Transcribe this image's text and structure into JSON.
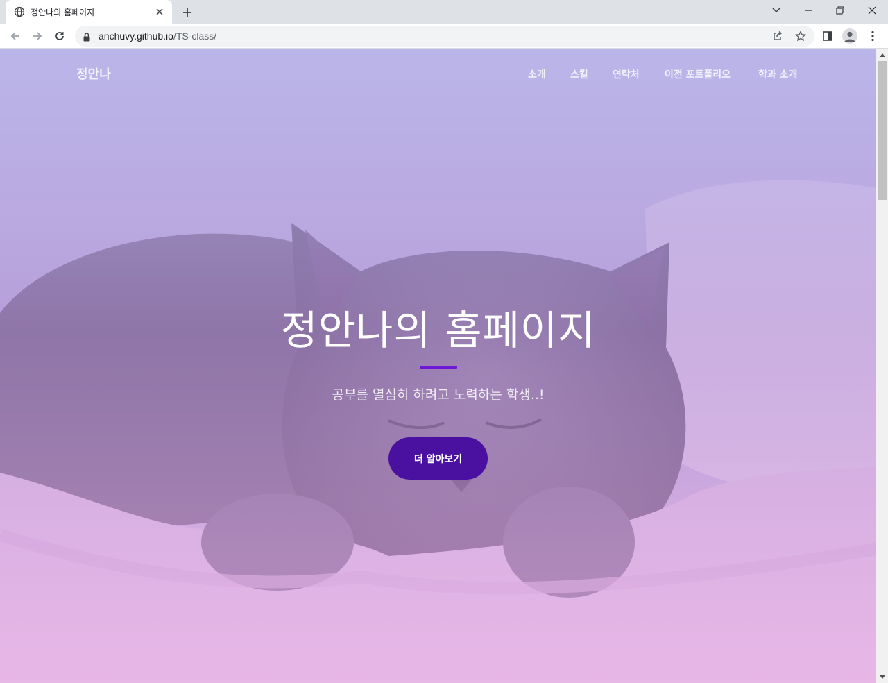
{
  "browser": {
    "tab_title": "정안나의 홈페이지",
    "url_host": "anchuvy.github.io",
    "url_path": "/TS-class/"
  },
  "site": {
    "brand": "정안나",
    "nav": [
      "소개",
      "스킬",
      "연락처",
      "이전 포트폴리오",
      "학과 소개"
    ],
    "hero_title": "정안나의 홈페이지",
    "hero_subtitle": "공부를 열심히 하려고 노력하는 학생..!",
    "cta_label": "더 알아보기"
  },
  "colors": {
    "accent": "#6f17d6",
    "cta_bg": "#4a10a0",
    "overlay_top": "#b2ace8",
    "overlay_bottom": "#e1a0e1"
  },
  "icons": {
    "tab": "globe-icon",
    "toolbar": [
      "back-icon",
      "forward-icon",
      "reload-icon",
      "lock-icon",
      "share-icon",
      "star-icon",
      "side-panel-icon",
      "profile-icon",
      "menu-icon"
    ]
  }
}
